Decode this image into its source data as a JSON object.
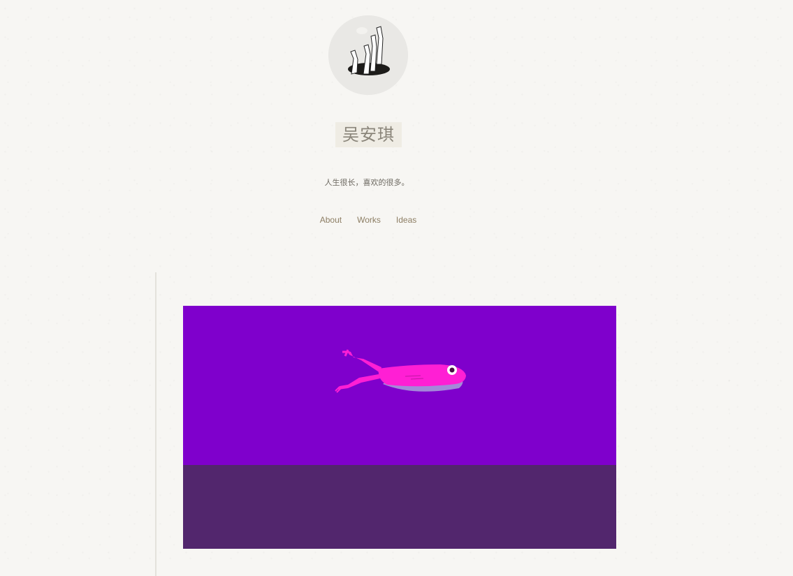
{
  "profile": {
    "name": "吴安琪",
    "tagline": "人生很长，喜欢的很多。",
    "avatar_icon": "legs-in-hole-illustration"
  },
  "nav": {
    "items": [
      {
        "label": "About"
      },
      {
        "label": "Works"
      },
      {
        "label": "Ideas"
      }
    ]
  },
  "post": {
    "image": "pink-frog-swimming-illustration",
    "colors": {
      "water": "#7f00cc",
      "ground": "#52266d",
      "frog": "#ff1fd4"
    }
  }
}
